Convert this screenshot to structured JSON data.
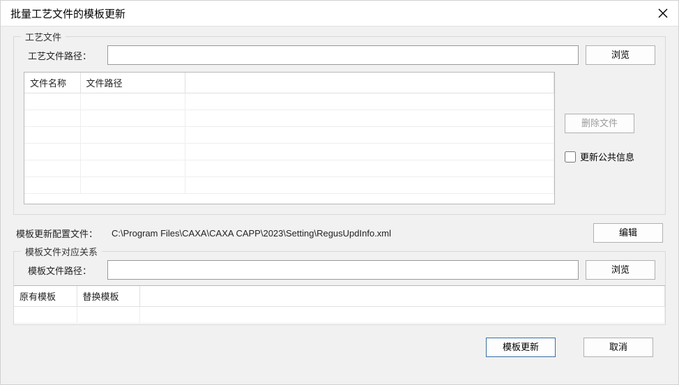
{
  "dialog": {
    "title": "批量工艺文件的模板更新"
  },
  "processFiles": {
    "groupLabel": "工艺文件",
    "pathLabel": "工艺文件路径：",
    "pathValue": "",
    "browseLabel": "浏览",
    "table": {
      "headers": {
        "name": "文件名称",
        "path": "文件路径"
      }
    },
    "deleteLabel": "删除文件",
    "updatePublicLabel": "更新公共信息",
    "updatePublicChecked": false
  },
  "configFile": {
    "label": "模板更新配置文件：",
    "value": "C:\\Program Files\\CAXA\\CAXA CAPP\\2023\\Setting\\RegusUpdInfo.xml",
    "editLabel": "编辑"
  },
  "templateMapping": {
    "groupLabel": "模板文件对应关系",
    "pathLabel": "模板文件路径：",
    "pathValue": "",
    "browseLabel": "浏览",
    "table": {
      "headers": {
        "original": "原有模板",
        "replace": "替换模板"
      }
    }
  },
  "footer": {
    "updateLabel": "模板更新",
    "cancelLabel": "取消"
  }
}
